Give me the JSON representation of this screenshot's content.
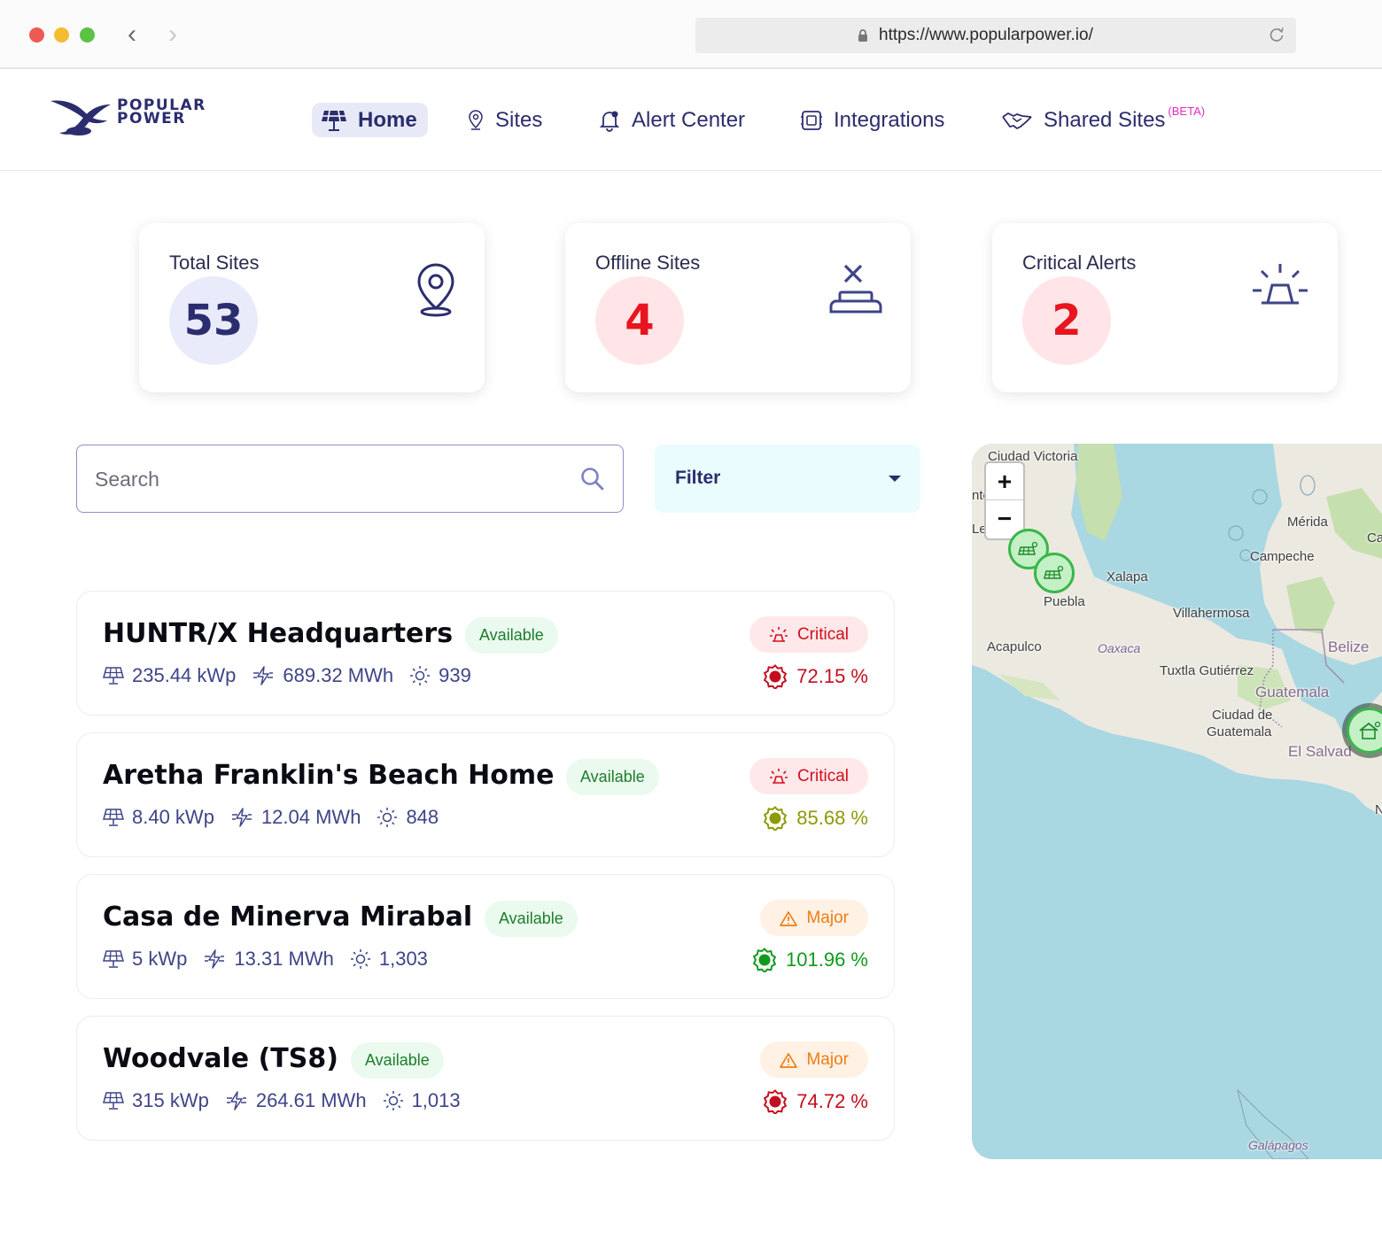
{
  "browser": {
    "url": "https://www.popularpower.io/"
  },
  "brand": {
    "line1": "POPULAR",
    "line2": "POWER"
  },
  "nav": {
    "home": "Home",
    "sites": "Sites",
    "alert_center": "Alert Center",
    "integrations": "Integrations",
    "shared_sites": "Shared Sites",
    "beta": "(BETA)"
  },
  "stats": {
    "total_sites": {
      "label": "Total Sites",
      "value": "53"
    },
    "offline_sites": {
      "label": "Offline Sites",
      "value": "4"
    },
    "critical_alerts": {
      "label": "Critical Alerts",
      "value": "2"
    }
  },
  "search": {
    "placeholder": "Search",
    "value": ""
  },
  "filter": {
    "label": "Filter"
  },
  "sites": [
    {
      "name": "HUNTR/X Headquarters",
      "status": "Available",
      "capacity": "235.44 kWp",
      "energy": "689.32 MWh",
      "irradiance": "939",
      "severity": "Critical",
      "performance": "72.15 %",
      "performance_color": "#c20f1f"
    },
    {
      "name": "Aretha Franklin's Beach Home",
      "status": "Available",
      "capacity": "8.40 kWp",
      "energy": "12.04 MWh",
      "irradiance": "848",
      "severity": "Critical",
      "performance": "85.68 %",
      "performance_color": "#8c9a06"
    },
    {
      "name": "Casa de Minerva Mirabal",
      "status": "Available",
      "capacity": "5 kWp",
      "energy": "13.31 MWh",
      "irradiance": "1,303",
      "severity": "Major",
      "performance": "101.96 %",
      "performance_color": "#0f9a1e"
    },
    {
      "name": "Woodvale (TS8)",
      "status": "Available",
      "capacity": "315 kWp",
      "energy": "264.61 MWh",
      "irradiance": "1,013",
      "severity": "Major",
      "performance": "74.72 %",
      "performance_color": "#c20f1f"
    }
  ],
  "map": {
    "zoom_in": "+",
    "zoom_out": "−",
    "labels": {
      "ciudad_victoria": "Ciudad Victoria",
      "merida": "Mérida",
      "campeche": "Campeche",
      "xalapa": "Xalapa",
      "puebla": "Puebla",
      "villahermosa": "Villahermosa",
      "acapulco": "Acapulco",
      "oaxaca": "Oaxaca",
      "belize": "Belize",
      "tuxtla": "Tuxtla Gutiérrez",
      "guatemala": "Guatemala",
      "ciudad_guatemala_1": "Ciudad de",
      "ciudad_guatemala_2": "Guatemala",
      "el_salvador": "El Salvad",
      "galapagos": "Galápagos",
      "edge_ca": "Ca",
      "edge_le": "Le",
      "edge_nte": "nte",
      "edge_n": "N"
    }
  },
  "colors": {
    "brand_navy": "#2b2d6e",
    "critical_red": "#d0101c",
    "major_orange": "#ef7d13",
    "available_green": "#1e7d2c",
    "nav_active_bg": "#e7e9f7"
  }
}
